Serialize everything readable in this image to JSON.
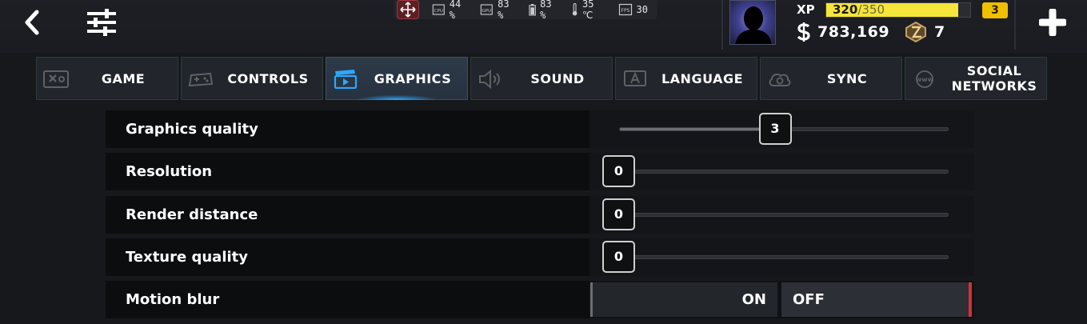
{
  "colors": {
    "accent_blue": "#2aa8ff",
    "xp_yellow": "#f6e53a",
    "level_badge": "#f0c000",
    "toggle_off_marker": "#d92e35"
  },
  "icons": {
    "back": "chevron-left-icon",
    "filters": "sliders-icon",
    "move": "move-arrows-icon",
    "cpu": "cpu-chip-icon",
    "gpu": "gpu-chip-icon",
    "battery": "battery-icon",
    "temperature": "thermometer-icon",
    "fps": "fps-icon",
    "money": "dollar-icon",
    "token": "token-icon",
    "plus": "plus-icon"
  },
  "perf": {
    "cpu": "44 %",
    "gpu": "83 %",
    "battery": "83 %",
    "temp": "35 ℃",
    "fps": "30"
  },
  "profile": {
    "xp_label": "XP",
    "xp_current": "320",
    "xp_max": "/350",
    "xp_fraction": 0.914,
    "level": "3",
    "money": "783,169",
    "tokens": "7"
  },
  "tabs": [
    {
      "label": "GAME",
      "icon": "game-settings-icon",
      "active": false
    },
    {
      "label": "CONTROLS",
      "icon": "gamepad-icon",
      "active": false
    },
    {
      "label": "GRAPHICS",
      "icon": "clapperboard-icon",
      "active": true
    },
    {
      "label": "SOUND",
      "icon": "speaker-icon",
      "active": false
    },
    {
      "label": "LANGUAGE",
      "icon": "language-icon",
      "active": false
    },
    {
      "label": "SYNC",
      "icon": "cloud-sync-icon",
      "active": false
    },
    {
      "label": "SOCIAL NETWORKS",
      "icon": "www-icon",
      "active": false
    }
  ],
  "settings": {
    "graphics_quality": {
      "label": "Graphics quality",
      "value": "3",
      "fraction": 0.5
    },
    "resolution": {
      "label": "Resolution",
      "value": "0",
      "fraction": 0
    },
    "render_distance": {
      "label": "Render distance",
      "value": "0",
      "fraction": 0
    },
    "texture_quality": {
      "label": "Texture quality",
      "value": "0",
      "fraction": 0
    },
    "motion_blur": {
      "label": "Motion blur",
      "on_label": "ON",
      "off_label": "OFF",
      "selected": "OFF"
    }
  }
}
